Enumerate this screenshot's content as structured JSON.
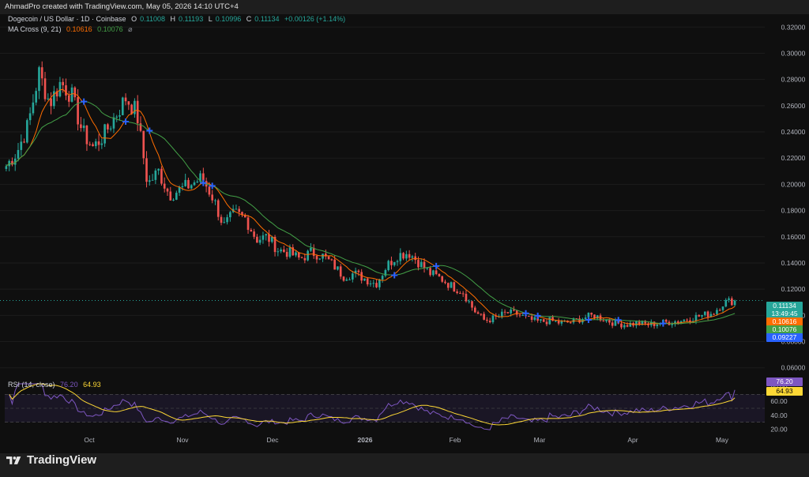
{
  "header": {
    "created_by": "AhmadPro created with TradingView.com, May 05, 2026 14:10 UTC+4"
  },
  "legend": {
    "symbol": "Dogecoin / US Dollar · 1D · Coinbase",
    "o_label": "O",
    "o_value": "0.11008",
    "h_label": "H",
    "h_value": "0.11193",
    "l_label": "L",
    "l_value": "0.10996",
    "c_label": "C",
    "c_value": "0.11134",
    "change": "+0.00126 (+1.14%)",
    "ma_label": "MA Cross (9, 21)",
    "ma_fast": "0.10616",
    "ma_slow": "0.10076",
    "ma_icon": "eye-off-icon"
  },
  "rsi_legend": {
    "label": "RSI (14, close)",
    "rsi": "76.20",
    "ma": "64.93"
  },
  "price_tags": {
    "last": "0.11134",
    "countdown": "13:49:45",
    "ma_fast": "0.10616",
    "ma_slow": "0.10076",
    "low_tag": "0.09227"
  },
  "rsi_tags": {
    "rsi": "76.20",
    "ma": "64.93"
  },
  "brand": {
    "name": "TradingView"
  },
  "colors": {
    "background": "#0f0f0f",
    "up": "#26a69a",
    "down": "#ef5350",
    "ma_fast": "#ff6d00",
    "ma_slow": "#43a047",
    "rsi_line": "#7e57c2",
    "rsi_ma": "#fdd835",
    "cross_marker": "#2962ff"
  },
  "chart_data": [
    {
      "type": "candlestick",
      "title": "Dogecoin / US Dollar · 1D · Coinbase",
      "y_axis_ticks": [
        "0.32000",
        "0.30000",
        "0.28000",
        "0.26000",
        "0.24000",
        "0.22000",
        "0.20000",
        "0.18000",
        "0.16000",
        "0.14000",
        "0.12000",
        "0.10000",
        "0.08000",
        "0.06000"
      ],
      "ylim": [
        0.055,
        0.325
      ],
      "x_axis_ticks": [
        "Oct",
        "Nov",
        "Dec",
        "2026",
        "Feb",
        "Mar",
        "Apr",
        "May"
      ],
      "close_path": [
        [
          "Sep 01",
          0.214
        ],
        [
          "Sep 05",
          0.225
        ],
        [
          "Sep 09",
          0.245
        ],
        [
          "Sep 12",
          0.285
        ],
        [
          "Sep 14",
          0.262
        ],
        [
          "Sep 17",
          0.278
        ],
        [
          "Sep 20",
          0.268
        ],
        [
          "Sep 23",
          0.24
        ],
        [
          "Sep 26",
          0.228
        ],
        [
          "Sep 29",
          0.238
        ],
        [
          "Oct 02",
          0.252
        ],
        [
          "Oct 05",
          0.266
        ],
        [
          "Oct 08",
          0.255
        ],
        [
          "Oct 10",
          0.2
        ],
        [
          "Oct 12",
          0.21
        ],
        [
          "Oct 15",
          0.192
        ],
        [
          "Oct 18",
          0.196
        ],
        [
          "Oct 22",
          0.2
        ],
        [
          "Oct 26",
          0.205
        ],
        [
          "Oct 30",
          0.19
        ],
        [
          "Nov 03",
          0.168
        ],
        [
          "Nov 07",
          0.178
        ],
        [
          "Nov 11",
          0.174
        ],
        [
          "Nov 15",
          0.158
        ],
        [
          "Nov 19",
          0.16
        ],
        [
          "Nov 23",
          0.15
        ],
        [
          "Nov 27",
          0.148
        ],
        [
          "Dec 01",
          0.143
        ],
        [
          "Dec 05",
          0.148
        ],
        [
          "Dec 09",
          0.146
        ],
        [
          "Dec 13",
          0.139
        ],
        [
          "Dec 17",
          0.13
        ],
        [
          "Dec 21",
          0.132
        ],
        [
          "Dec 25",
          0.128
        ],
        [
          "Dec 29",
          0.124
        ],
        [
          "Jan 02",
          0.138
        ],
        [
          "Jan 05",
          0.146
        ],
        [
          "Jan 08",
          0.148
        ],
        [
          "Jan 12",
          0.14
        ],
        [
          "Jan 16",
          0.132
        ],
        [
          "Jan 20",
          0.128
        ],
        [
          "Jan 24",
          0.122
        ],
        [
          "Jan 28",
          0.118
        ],
        [
          "Feb 01",
          0.104
        ],
        [
          "Feb 05",
          0.096
        ],
        [
          "Feb 09",
          0.098
        ],
        [
          "Feb 13",
          0.102
        ],
        [
          "Feb 17",
          0.101
        ],
        [
          "Feb 21",
          0.097
        ],
        [
          "Feb 25",
          0.095
        ],
        [
          "Mar 01",
          0.096
        ],
        [
          "Mar 05",
          0.094
        ],
        [
          "Mar 09",
          0.095
        ],
        [
          "Mar 13",
          0.098
        ],
        [
          "Mar 17",
          0.1
        ],
        [
          "Mar 21",
          0.097
        ],
        [
          "Mar 25",
          0.094
        ],
        [
          "Mar 29",
          0.093
        ],
        [
          "Apr 02",
          0.094
        ],
        [
          "Apr 06",
          0.093
        ],
        [
          "Apr 10",
          0.094
        ],
        [
          "Apr 14",
          0.095
        ],
        [
          "Apr 18",
          0.096
        ],
        [
          "Apr 22",
          0.098
        ],
        [
          "Apr 26",
          0.1
        ],
        [
          "Apr 30",
          0.102
        ],
        [
          "May 03",
          0.11
        ],
        [
          "May 05",
          0.11134
        ]
      ],
      "series": [
        {
          "name": "MA Cross (9, 21) fast",
          "last": 0.10616
        },
        {
          "name": "MA Cross (9, 21) slow",
          "last": 0.10076
        }
      ],
      "last_price": 0.11134,
      "current_price_line": 0.11134
    },
    {
      "type": "line",
      "title": "RSI (14, close)",
      "y_axis_ticks": [
        "80.00",
        "60.00",
        "40.00",
        "20.00"
      ],
      "ylim": [
        15,
        85
      ],
      "bands": [
        30,
        70
      ],
      "series": [
        {
          "name": "RSI",
          "last": 76.2
        },
        {
          "name": "MA",
          "last": 64.93
        }
      ]
    }
  ]
}
